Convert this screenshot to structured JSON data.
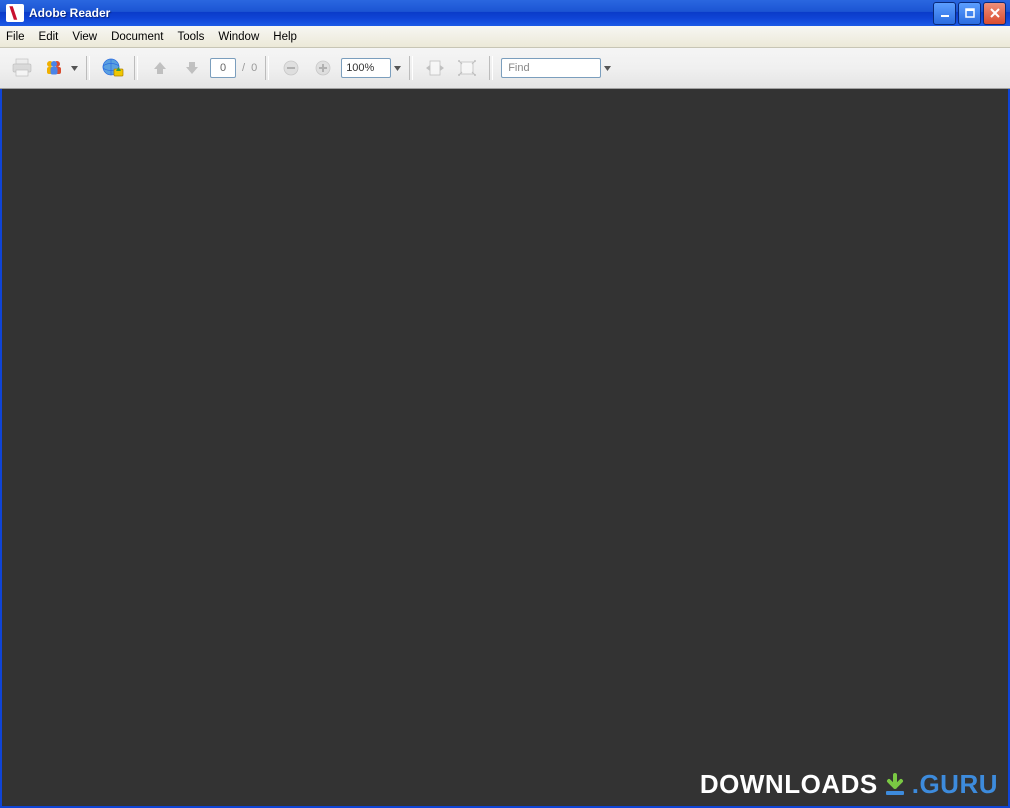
{
  "titlebar": {
    "app_name": "Adobe Reader"
  },
  "menus": {
    "file": "File",
    "edit": "Edit",
    "view": "View",
    "document": "Document",
    "tools": "Tools",
    "window": "Window",
    "help": "Help"
  },
  "toolbar": {
    "page_current": "0",
    "page_separator": "/",
    "page_total": "0",
    "zoom_value": "100%",
    "find_placeholder": "Find"
  },
  "watermark": {
    "left": "DOWNLOADS",
    "right": ".GURU"
  }
}
